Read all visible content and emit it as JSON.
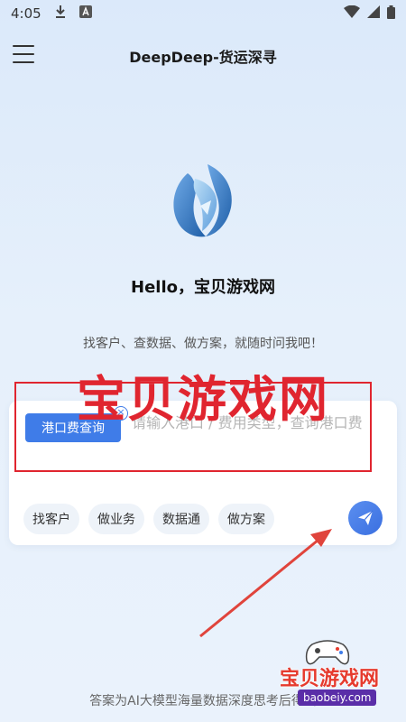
{
  "status_bar": {
    "time": "4:05",
    "icons": [
      "download-icon",
      "a-notification-icon",
      "wifi-icon",
      "signal-icon",
      "battery-icon"
    ]
  },
  "header": {
    "title": "DeepDeep-货运深寻",
    "menu_icon": "hamburger-menu-icon"
  },
  "hero": {
    "greeting": "Hello，宝贝游戏网",
    "subtitle": "找客户、查数据、做方案，就随时问我吧！"
  },
  "watermark": {
    "text": "宝贝游戏网"
  },
  "composer": {
    "selected_tag": "港口费查询",
    "placeholder": "请输入港口 / 费用类型，查询港口费",
    "quick_actions": [
      "找客户",
      "做业务",
      "数据通",
      "做方案"
    ],
    "send_icon": "paper-plane-icon"
  },
  "footer": {
    "note": "答案为AI大模型海量数据深度思考后得出"
  },
  "site_badge": {
    "name": "宝贝游戏网",
    "url": "baobeiy.com"
  },
  "colors": {
    "accent": "#3f7ce8",
    "annotation_red": "#e0252f",
    "background": "#e6f0fb"
  }
}
